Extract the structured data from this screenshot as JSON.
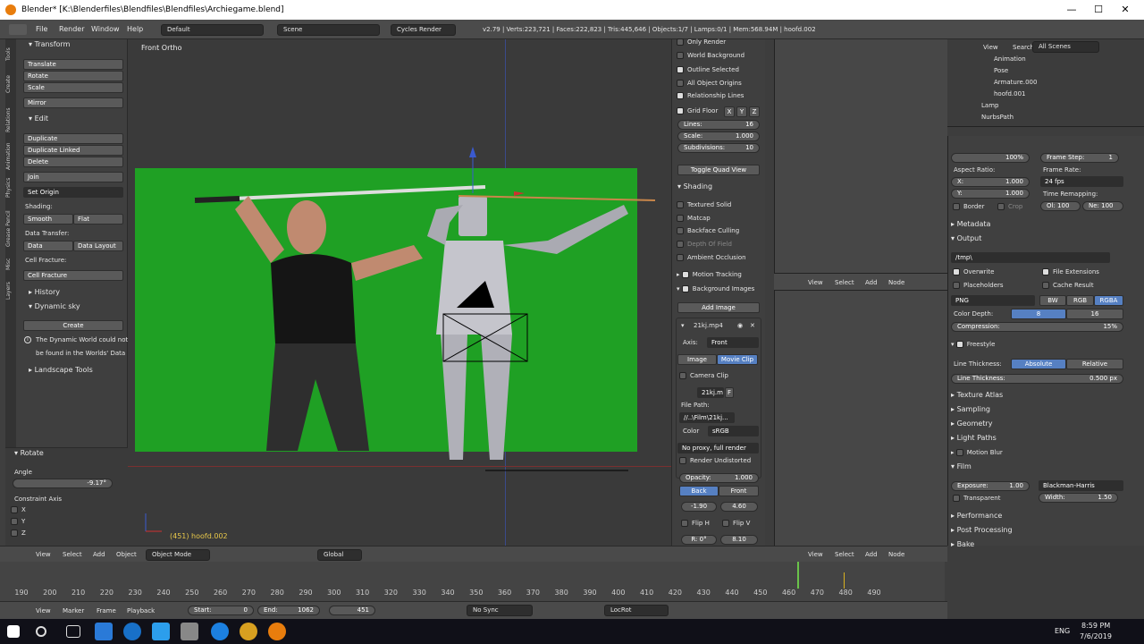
{
  "window": {
    "title": "Blender* [K:\\Blenderfiles\\Blendfiles\\Blendfiles\\Archiegame.blend]",
    "minimize": "—",
    "maximize": "☐",
    "close": "✕"
  },
  "info_header": {
    "menus": [
      "File",
      "Render",
      "Window",
      "Help"
    ],
    "layout": "Default",
    "scene": "Scene",
    "engine": "Cycles Render",
    "stats": "v2.79 | Verts:223,721 | Faces:222,823 | Tris:445,646 | Objects:1/7 | Lamps:0/1 | Mem:568.94M | hoofd.002"
  },
  "vtabs": [
    "Tools",
    "Create",
    "Relations",
    "Animation",
    "Physics",
    "Grease Pencil",
    "Misc",
    "Layers"
  ],
  "tools": {
    "transform_header": "Transform",
    "translate": "Translate",
    "rotate": "Rotate",
    "scale": "Scale",
    "mirror": "Mirror",
    "edit_header": "Edit",
    "duplicate": "Duplicate",
    "duplicate_linked": "Duplicate Linked",
    "delete": "Delete",
    "join": "Join",
    "set_origin": "Set Origin",
    "shading_label": "Shading:",
    "smooth": "Smooth",
    "flat": "Flat",
    "data_transfer_label": "Data Transfer:",
    "data": "Data",
    "data_layout": "Data Layout",
    "cell_fracture_label": "Cell Fracture:",
    "cell_fracture": "Cell Fracture",
    "history": "History",
    "dynamic_sky": "Dynamic sky",
    "create": "Create",
    "info_text_1": "The Dynamic World could not",
    "info_text_2": "be found in the Worlds' Data",
    "landscape_tools": "Landscape Tools"
  },
  "operator": {
    "header": "Rotate",
    "angle_label": "Angle",
    "angle_value": "-9.17°",
    "constraint_label": "Constraint Axis",
    "x": "X",
    "y": "Y",
    "z": "Z"
  },
  "viewport": {
    "label": "Front Ortho",
    "object_info": "(451) hoofd.002"
  },
  "view3d_header": {
    "view": "View",
    "select": "Select",
    "add": "Add",
    "object": "Object",
    "mode": "Object Mode",
    "orientation": "Global"
  },
  "npanel": {
    "only_render": "Only Render",
    "world_background": "World Background",
    "outline_selected": "Outline Selected",
    "all_object_origins": "All Object Origins",
    "relationship_lines": "Relationship Lines",
    "grid_floor": "Grid Floor",
    "gx": "X",
    "gy": "Y",
    "gz": "Z",
    "lines_label": "Lines:",
    "lines_value": "16",
    "scale_label": "Scale:",
    "scale_value": "1.000",
    "subdiv_label": "Subdivisions:",
    "subdiv_value": "10",
    "toggle_quad": "Toggle Quad View",
    "shading": "Shading",
    "textured_solid": "Textured Solid",
    "matcap": "Matcap",
    "backface_culling": "Backface Culling",
    "depth_of_field": "Depth Of Field",
    "ambient_occlusion": "Ambient Occlusion",
    "motion_tracking": "Motion Tracking",
    "background_images": "Background Images",
    "add_image": "Add Image",
    "clip_name": "21kj.mp4",
    "axis_label": "Axis:",
    "axis_value": "Front",
    "image": "Image",
    "movie_clip": "Movie Clip",
    "camera_clip": "Camera Clip",
    "clip_field": "21kj.m",
    "clip_f": "F",
    "file_path_label": "File Path:",
    "file_path": "//..\\Film\\21kj...",
    "color_label": "Color",
    "color_value": "sRGB",
    "proxy": "No proxy, full render",
    "render_undistorted": "Render Undistorted",
    "opacity_label": "Opacity:",
    "opacity_value": "1.000",
    "back": "Back",
    "front": "Front",
    "off_x": "-1.90",
    "off_y": "4.60",
    "flip_h": "Flip H",
    "flip_v": "Flip V",
    "rot": "R: 0°",
    "size": "8.10"
  },
  "node_header": {
    "view": "View",
    "select": "Select",
    "add": "Add",
    "node": "Node"
  },
  "outliner": {
    "view": "View",
    "search": "Search",
    "filter": "All Scenes",
    "items": [
      "Animation",
      "Pose",
      "Armature.000",
      "hoofd.001",
      "Lamp",
      "NurbsPath"
    ]
  },
  "props": {
    "percent": "100%",
    "frame_step": "Frame Step:",
    "frame_step_value": "1",
    "aspect_ratio": "Aspect Ratio:",
    "frame_rate": "Frame Rate:",
    "ax_label": "X:",
    "ax_value": "1.000",
    "ay_label": "Y:",
    "ay_value": "1.000",
    "fps": "24 fps",
    "time_remap": "Time Remapping:",
    "old": "Ol: 100",
    "new": "Ne: 100",
    "border": "Border",
    "crop": "Crop",
    "metadata": "Metadata",
    "output": "Output",
    "path": "/tmp\\",
    "overwrite": "Overwrite",
    "file_ext": "File Extensions",
    "placeholders": "Placeholders",
    "cache_result": "Cache Result",
    "format": "PNG",
    "bw": "BW",
    "rgb": "RGB",
    "rgba": "RGBA",
    "color_depth": "Color Depth:",
    "depth8": "8",
    "depth16": "16",
    "compression": "Compression:",
    "compression_value": "15%",
    "freestyle": "Freestyle",
    "line_thickness": "Line Thickness:",
    "absolute": "Absolute",
    "relative": "Relative",
    "line_thickness_value_label": "Line Thickness:",
    "line_thickness_value": "0.500 px",
    "texture_atlas": "Texture Atlas",
    "sampling": "Sampling",
    "geometry": "Geometry",
    "light_paths": "Light Paths",
    "motion_blur": "Motion Blur",
    "film": "Film",
    "exposure": "Exposure:",
    "exposure_value": "1.00",
    "filter": "Blackman-Harris",
    "transparent": "Transparent",
    "width_label": "Width:",
    "width_value": "1.50",
    "performance": "Performance",
    "post_processing": "Post Processing",
    "bake": "Bake"
  },
  "timeline": {
    "ticks": [
      "190",
      "200",
      "210",
      "220",
      "230",
      "240",
      "250",
      "260",
      "270",
      "280",
      "290",
      "300",
      "310",
      "320",
      "330",
      "340",
      "350",
      "360",
      "370",
      "380",
      "390",
      "400",
      "410",
      "420",
      "430",
      "440",
      "450",
      "460",
      "470",
      "480",
      "490"
    ],
    "view": "View",
    "marker": "Marker",
    "frame": "Frame",
    "playback": "Playback",
    "start_label": "Start:",
    "start_value": "0",
    "end_label": "End:",
    "end_value": "1062",
    "current": "451",
    "sync": "No Sync",
    "keying": "LocRot"
  },
  "taskbar": {
    "lang": "ENG",
    "time": "8:59 PM",
    "date": "7/6/2019"
  },
  "colors": {
    "green_screen": "#1fa024",
    "accent": "#5680c2",
    "blender_orange": "#e87d0d"
  }
}
